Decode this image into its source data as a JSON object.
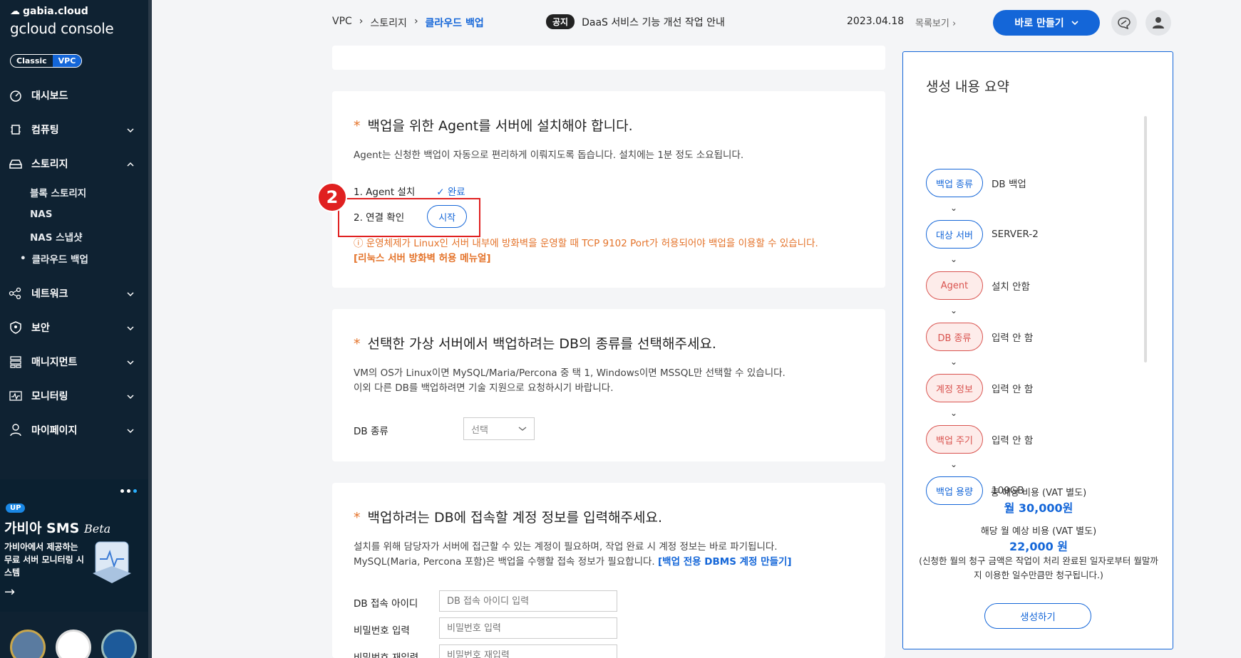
{
  "sidebar": {
    "brand_top": "gabia.cloud",
    "brand_main": "gcloud console",
    "toggle": [
      "Classic",
      "VPC"
    ],
    "nav": [
      {
        "label": "대시보드",
        "icon": "dashboard-icon"
      },
      {
        "label": "컴퓨팅",
        "icon": "chip-icon"
      },
      {
        "label": "스토리지",
        "icon": "storage-icon"
      },
      {
        "label": "네트워크",
        "icon": "network-icon"
      },
      {
        "label": "보안",
        "icon": "shield-icon"
      },
      {
        "label": "매니지먼트",
        "icon": "management-icon"
      },
      {
        "label": "모니터링",
        "icon": "monitor-icon"
      },
      {
        "label": "마이페이지",
        "icon": "user-icon"
      }
    ],
    "storage_sub": [
      "블록 스토리지",
      "NAS",
      "NAS 스냅샷",
      "클라우드 백업"
    ],
    "promo": {
      "badge": "UP",
      "title": "가비아 SMS",
      "title_em": "Beta",
      "desc": "가비아에서 제공하는 무료 서버 모니터링 시스템"
    }
  },
  "header": {
    "breadcrumb": [
      "VPC",
      "스토리지",
      "클라우드 백업"
    ],
    "notice_badge": "공지",
    "notice_text": "DaaS 서비스 기능 개선 작업 안내",
    "notice_date": "2023.04.18",
    "notice_list": "목록보기",
    "create_button": "바로 만들기"
  },
  "agent_section": {
    "title": "백업을 위한 Agent를 서버에 설치해야 합니다.",
    "desc": "Agent는 신청한 백업이 자동으로 편리하게 이뤄지도록 돕습니다. 설치에는 1분 정도 소요됩니다.",
    "step1_label": "1. Agent 설치",
    "step1_status": "완료",
    "step2_label": "2. 연결 확인",
    "step2_button": "시작",
    "badge_number": "2",
    "warning": "운영체제가 Linux인 서버 내부에 방화벽을 운영할 때 TCP 9102 Port가 허용되어야 백업을 이용할 수 있습니다.",
    "manual_link": "[리눅스 서버 방화벽 허용 메뉴얼]"
  },
  "db_section": {
    "title": "선택한 가상 서버에서 백업하려는 DB의 종류를 선택해주세요.",
    "desc1": "VM의 OS가 Linux이면 MySQL/Maria/Percona 중 택 1, Windows이면 MSSQL만 선택할 수 있습니다.",
    "desc2": "이외 다른 DB를 백업하려면 기술 지원으로 요청하시기 바랍니다.",
    "field_label": "DB 종류",
    "select_value": "선택"
  },
  "account_section": {
    "title": "백업하려는 DB에 접속할 계정 정보를 입력해주세요.",
    "desc1": "설치를 위해 담당자가 서버에 접근할 수 있는 계정이 필요하며, 작업 완료 시 계정 정보는 바로 파기됩니다.",
    "desc2": "MySQL(Maria, Percona 포함)은 백업을 수행할 접속 정보가 필요합니다.",
    "desc2_link": "[백업 전용 DBMS 계정 만들기]",
    "id_label": "DB 접속 아이디",
    "id_placeholder": "DB 접속 아이디 입력",
    "pw_label": "비밀번호 입력",
    "pw_placeholder": "비밀번호 입력",
    "pw2_label": "비밀번호 재입력",
    "pw2_placeholder": "비밀번호 재입력"
  },
  "summary": {
    "title": "생성 내용 요약",
    "rows": [
      {
        "pill": "백업 종류",
        "value": "DB 백업",
        "state": "ok"
      },
      {
        "pill": "대상 서버",
        "value": "SERVER-2",
        "state": "ok"
      },
      {
        "pill": "Agent",
        "value": "설치 안함",
        "state": "pending"
      },
      {
        "pill": "DB 종류",
        "value": "입력 안 함",
        "state": "pending"
      },
      {
        "pill": "계정 정보",
        "value": "입력 안 함",
        "state": "pending"
      },
      {
        "pill": "백업 주기",
        "value": "입력 안 함",
        "state": "pending"
      },
      {
        "pill": "백업 용량",
        "value": "100GB",
        "state": "ok"
      }
    ],
    "total_label": "총 예상 비용 (VAT 별도)",
    "total_value": "월 30,000원",
    "month_label": "해당 월 예상 비용 (VAT 별도)",
    "month_value": "22,000 원",
    "note": "(신청한 월의 청구 금액은 작업이 처리 완료된 일자로부터 월말까지 이용한 일수만큼만 청구됩니다.)",
    "generate_button": "생성하기"
  },
  "colors": {
    "accent": "#1466d8",
    "sidebar": "#0f2232",
    "warning": "#e4732a",
    "alert": "#e02020"
  }
}
